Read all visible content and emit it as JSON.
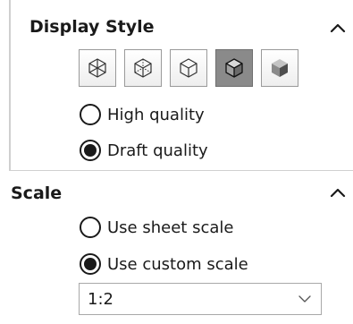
{
  "display_style": {
    "title": "Display Style",
    "collapse_icon": "chevron-up-icon",
    "modes": [
      {
        "icon": "wireframe-icon",
        "active": false
      },
      {
        "icon": "hidden-lines-visible-icon",
        "active": false
      },
      {
        "icon": "hidden-lines-removed-icon",
        "active": false
      },
      {
        "icon": "shaded-with-edges-icon",
        "active": true
      },
      {
        "icon": "shaded-icon",
        "active": false
      }
    ],
    "options": [
      {
        "label": "High quality",
        "checked": false
      },
      {
        "label": "Draft quality",
        "checked": true
      }
    ]
  },
  "scale": {
    "title": "Scale",
    "collapse_icon": "chevron-up-icon",
    "options": [
      {
        "label": "Use sheet scale",
        "checked": false
      },
      {
        "label": "Use custom scale",
        "checked": true
      }
    ],
    "custom_scale_value": "1:2",
    "dropdown_icon": "chevron-down-icon"
  }
}
